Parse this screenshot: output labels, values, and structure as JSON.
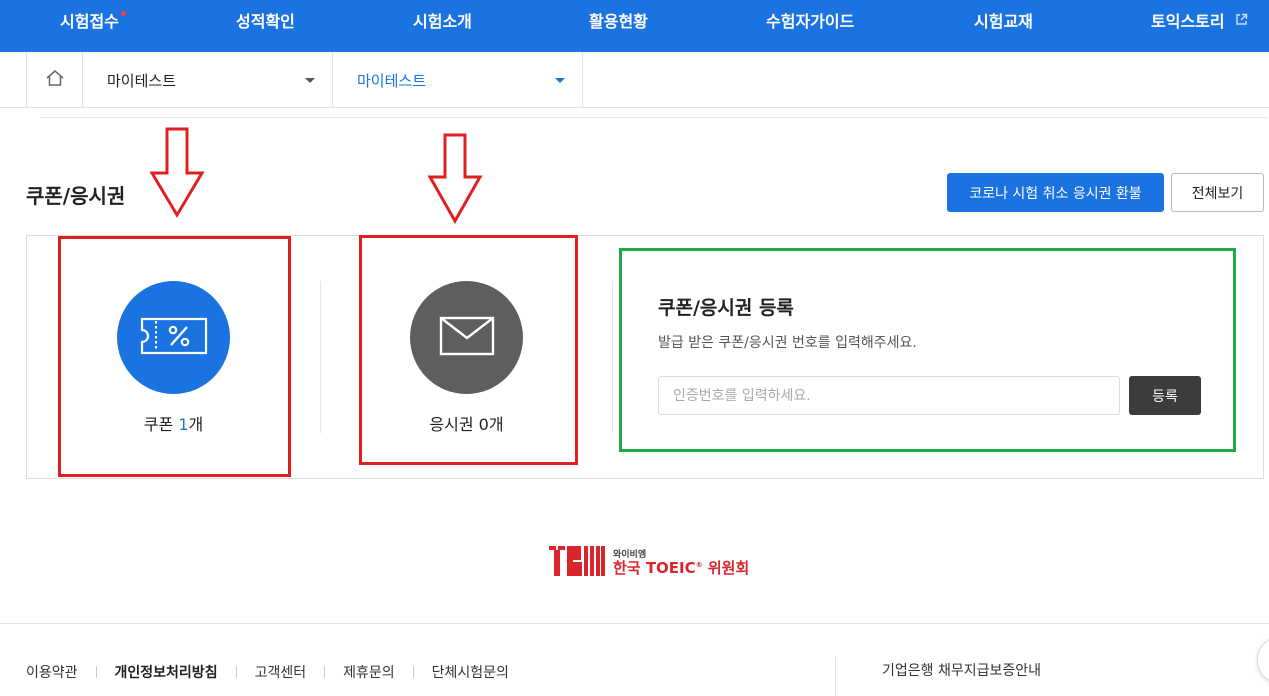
{
  "nav": {
    "items": [
      {
        "label": "시험접수"
      },
      {
        "label": "성적확인"
      },
      {
        "label": "시험소개"
      },
      {
        "label": "활용현황"
      },
      {
        "label": "수험자가이드"
      },
      {
        "label": "시험교재"
      },
      {
        "label": "토익스토리"
      }
    ],
    "bg_color": "#1a73e0"
  },
  "breadcrumb": {
    "level1": "마이테스트",
    "level2": "마이테스트"
  },
  "section": {
    "title": "쿠폰/응시권",
    "refund_button": "코로나 시험 취소 응시권 환불",
    "view_all_button": "전체보기"
  },
  "coupon": {
    "label": "쿠폰",
    "count": "1",
    "unit": "개"
  },
  "ticket": {
    "label": "응시권",
    "count": "0",
    "unit": "개"
  },
  "register": {
    "title": "쿠폰/응시권 등록",
    "description": "발급 받은 쿠폰/응시권 번호를 입력해주세요.",
    "input_placeholder": "인증번호를 입력하세요.",
    "input_value": "",
    "button": "등록"
  },
  "logo": {
    "small_text": "와이비엠",
    "main_text": "한국 TOEIC",
    "reg_mark": "®",
    "suffix": " 위원회"
  },
  "footer": {
    "links": [
      {
        "label": "이용약관"
      },
      {
        "label": "개인정보처리방침"
      },
      {
        "label": "고객센터"
      },
      {
        "label": "제휴문의"
      },
      {
        "label": "단체시험문의"
      }
    ],
    "right_text": "기업은행 채무지급보증안내"
  },
  "icons": {
    "home": "home-icon",
    "caret": "caret-down-icon",
    "coupon": "coupon-percent-icon",
    "ticket": "envelope-icon",
    "external": "external-link-icon"
  },
  "colors": {
    "primary": "#1a73e0",
    "annotation_red": "#e02020",
    "annotation_green": "#22aa44",
    "dark_button": "#3c3c3c",
    "gray_circle": "#5e5e5e"
  }
}
